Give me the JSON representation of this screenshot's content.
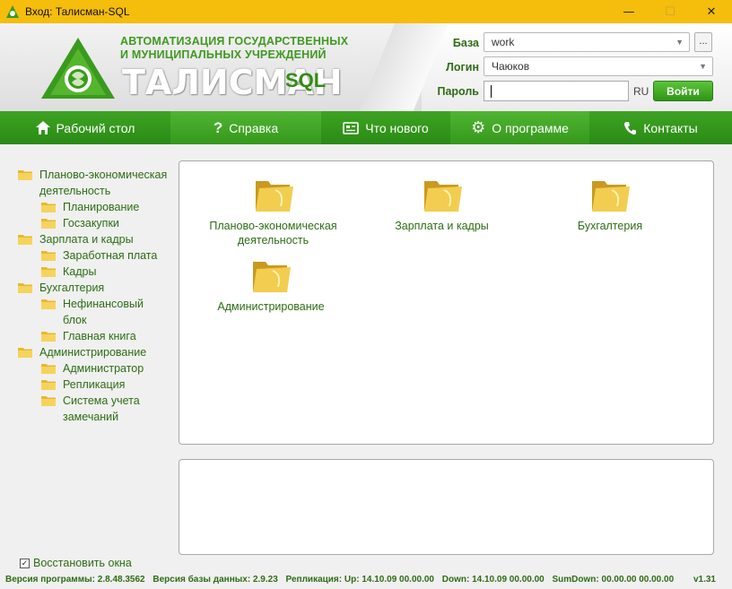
{
  "window": {
    "title": "Вход: Талисман-SQL",
    "minimize": "—",
    "maximize": "☐",
    "close": "✕"
  },
  "header": {
    "slogan_line1": "АВТОМАТИЗАЦИЯ ГОСУДАРСТВЕННЫХ",
    "slogan_line2": "И МУНИЦИПАЛЬНЫХ УЧРЕЖДЕНИЙ",
    "brand": "ТАЛИСМАН",
    "brand_suffix": "SQL"
  },
  "login": {
    "base_label": "База",
    "base_value": "work",
    "browse_label": "...",
    "login_label": "Логин",
    "login_value": "Чаюков",
    "password_label": "Пароль",
    "password_value": "",
    "lang": "RU",
    "enter_label": "Войти"
  },
  "nav": [
    {
      "label": "Рабочий стол",
      "icon": "home-icon"
    },
    {
      "label": "Справка",
      "icon": "question-icon"
    },
    {
      "label": "Что нового",
      "icon": "news-icon"
    },
    {
      "label": "О программе",
      "icon": "gear-icon"
    },
    {
      "label": "Контакты",
      "icon": "phone-icon"
    }
  ],
  "sidebar": {
    "items": [
      {
        "label": "Планово-экономическая деятельность",
        "level": 0
      },
      {
        "label": "Планирование",
        "level": 1
      },
      {
        "label": "Госзакупки",
        "level": 1
      },
      {
        "label": "Зарплата и кадры",
        "level": 0
      },
      {
        "label": "Заработная плата",
        "level": 1
      },
      {
        "label": "Кадры",
        "level": 1
      },
      {
        "label": "Бухгалтерия",
        "level": 0
      },
      {
        "label": "Нефинансовый блок",
        "level": 1
      },
      {
        "label": "Главная книга",
        "level": 1
      },
      {
        "label": "Администрирование",
        "level": 0
      },
      {
        "label": "Администратор",
        "level": 1
      },
      {
        "label": "Репликация",
        "level": 1
      },
      {
        "label": "Система учета замечаний",
        "level": 1
      }
    ]
  },
  "tiles": [
    {
      "label": "Планово-экономическая деятельность"
    },
    {
      "label": "Зарплата и кадры"
    },
    {
      "label": "Бухгалтерия"
    },
    {
      "label": "Администрирование"
    }
  ],
  "restore": {
    "label": "Восстановить окна",
    "checked": true
  },
  "status": {
    "prog_label": "Версия программы:",
    "prog_value": "2.8.48.3562",
    "db_label": "Версия базы данных:",
    "db_value": "2.9.23",
    "repl_label": "Репликация:",
    "up_label": "Up:",
    "up_value": "14.10.09 00.00.00",
    "down_label": "Down:",
    "down_value": "14.10.09 00.00.00",
    "sumdown_label": "SumDown:",
    "sumdown_value": "00.00.00 00.00.00",
    "version": "v1.31"
  },
  "colors": {
    "accent": "#2f9516",
    "titlebar": "#f5bd0c",
    "text_green": "#2d6d14"
  }
}
